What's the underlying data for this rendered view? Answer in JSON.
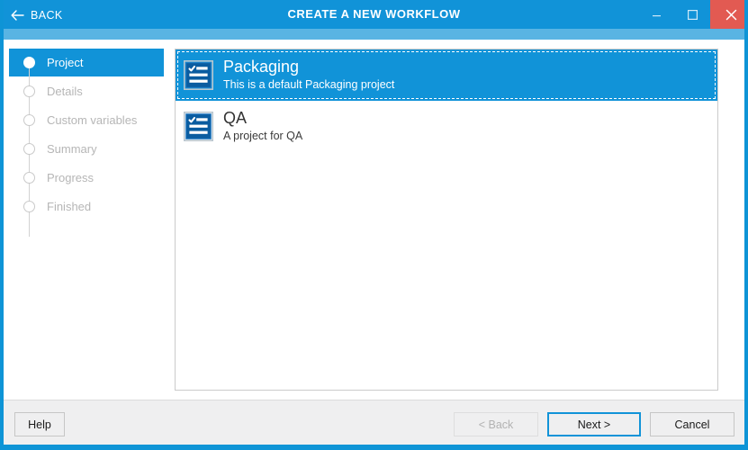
{
  "titlebar": {
    "back_label": "BACK",
    "back_icon": "arrow-left-icon",
    "title": "CREATE A NEW WORKFLOW",
    "minimize_icon": "minimize-icon",
    "maximize_icon": "maximize-icon",
    "close_icon": "close-icon",
    "background_color": "#1193d8",
    "accent_strip_color": "#59b4e3",
    "close_button_color": "#e25a52"
  },
  "sidebar": {
    "steps": [
      {
        "label": "Project",
        "state": "active"
      },
      {
        "label": "Details",
        "state": "pending"
      },
      {
        "label": "Custom variables",
        "state": "pending"
      },
      {
        "label": "Summary",
        "state": "pending"
      },
      {
        "label": "Progress",
        "state": "pending"
      },
      {
        "label": "Finished",
        "state": "pending"
      }
    ],
    "active_color": "#1193d8",
    "pending_text_color": "#b6b6b6"
  },
  "project_list": {
    "items": [
      {
        "icon": "checklist-icon",
        "title": "Packaging",
        "description": "This is a default Packaging project",
        "selected": true
      },
      {
        "icon": "checklist-icon",
        "title": "QA",
        "description": "A project for QA",
        "selected": false
      }
    ]
  },
  "footer": {
    "help_label": "Help",
    "back_label": "< Back",
    "next_label": "Next >",
    "cancel_label": "Cancel",
    "back_enabled": false,
    "next_focused": true
  }
}
